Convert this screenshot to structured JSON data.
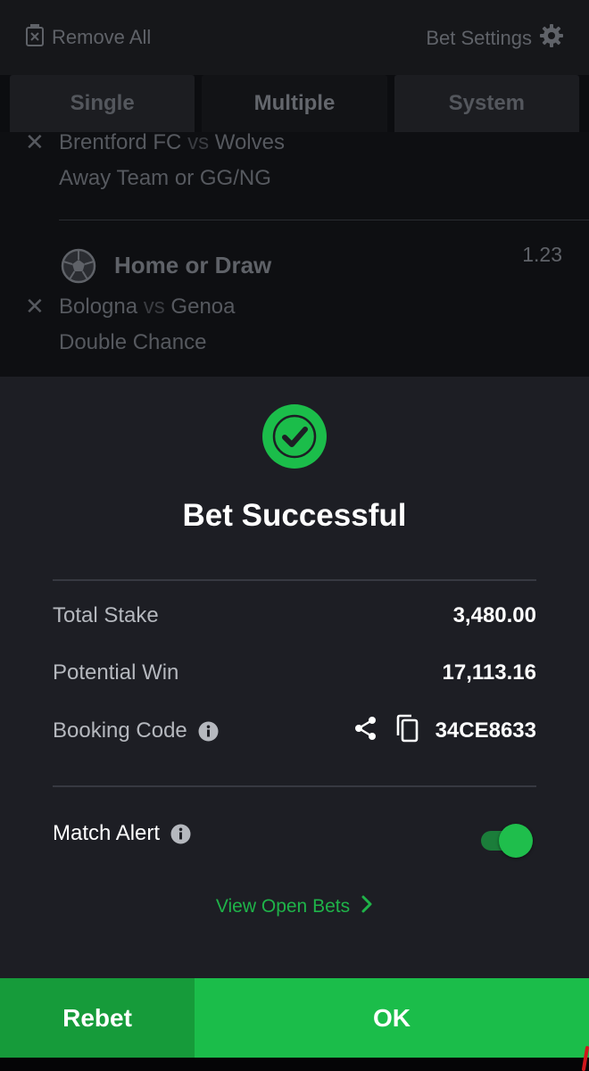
{
  "topbar": {
    "remove_all": "Remove All",
    "bet_settings": "Bet Settings"
  },
  "tabs": [
    {
      "label": "Single",
      "active": false
    },
    {
      "label": "Multiple",
      "active": true
    },
    {
      "label": "System",
      "active": false
    }
  ],
  "legs": [
    {
      "home": "Brentford FC",
      "vs": "vs",
      "away": "Wolves",
      "market": "Away Team or GG/NG"
    },
    {
      "icon": "soccer-ball-icon",
      "selection": "Home or Draw",
      "odds": "1.23",
      "home": "Bologna",
      "vs": "vs",
      "away": "Genoa",
      "market": "Double Chance"
    }
  ],
  "result": {
    "icon": "check-circle-icon",
    "title": "Bet Successful",
    "total_stake_label": "Total Stake",
    "total_stake_value": "3,480.00",
    "potential_win_label": "Potential Win",
    "potential_win_value": "17,113.16",
    "booking_code_label": "Booking Code",
    "booking_code_value": "34CE8633",
    "match_alert_label": "Match Alert",
    "match_alert_on": true,
    "view_open_bets": "View Open Bets"
  },
  "buttons": {
    "rebet": "Rebet",
    "ok": "OK"
  },
  "colors": {
    "accent_green": "#1bbd4a",
    "rebet_green": "#169b3a",
    "sheet_background": "#1d1e24"
  }
}
